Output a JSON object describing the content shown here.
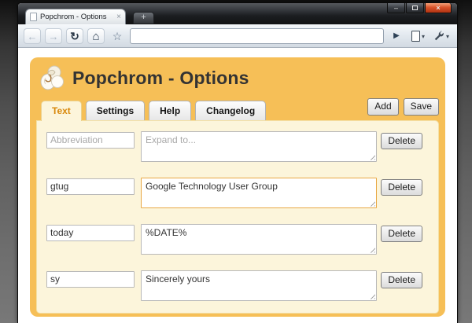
{
  "browser": {
    "tab": {
      "title": "Popchrom - Options",
      "close_icon": "×"
    },
    "new_tab_icon": "+",
    "window_controls": {
      "minimize": "–",
      "close": "×"
    },
    "toolbar": {
      "back_icon": "←",
      "forward_icon": "→",
      "reload_icon": "↻",
      "home_icon": "⌂",
      "star_icon": "☆",
      "go_icon": "▶",
      "menu_caret": "▾",
      "address_value": ""
    }
  },
  "page": {
    "title": "Popchrom - Options",
    "tabs": [
      {
        "label": "Text",
        "active": true
      },
      {
        "label": "Settings",
        "active": false
      },
      {
        "label": "Help",
        "active": false
      },
      {
        "label": "Changelog",
        "active": false
      }
    ],
    "actions": {
      "add": "Add",
      "save": "Save",
      "delete": "Delete"
    },
    "rows": [
      {
        "abbr": "",
        "abbr_placeholder": "Abbreviation",
        "expansion": "",
        "expansion_placeholder": "Expand to...",
        "focused": false
      },
      {
        "abbr": "gtug",
        "expansion": "Google Technology User Group",
        "focused": true
      },
      {
        "abbr": "today",
        "expansion": "%DATE%",
        "focused": false
      },
      {
        "abbr": "sy",
        "expansion": "Sincerely yours",
        "focused": false
      }
    ],
    "colors": {
      "panel_orange": "#F6BF57",
      "content_cream": "#FCF5DB",
      "active_tab_text": "#D8880A",
      "focus_border": "#E8A845"
    }
  }
}
